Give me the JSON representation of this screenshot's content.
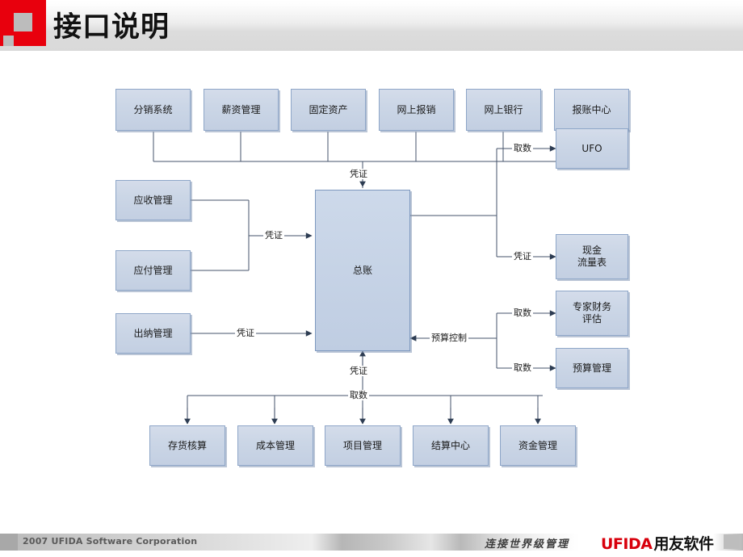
{
  "header": {
    "title": "接口说明",
    "logo_icon": "ufida-red-square-logo"
  },
  "diagram": {
    "hub": {
      "label": "总账"
    },
    "top_row": [
      {
        "label": "分销系统"
      },
      {
        "label": "薪资管理"
      },
      {
        "label": "固定资产"
      },
      {
        "label": "网上报销"
      },
      {
        "label": "网上银行"
      },
      {
        "label": "报账中心"
      }
    ],
    "left_column": [
      {
        "label": "应收管理"
      },
      {
        "label": "应付管理"
      },
      {
        "label": "出纳管理"
      }
    ],
    "right_column": [
      {
        "label": "UFO"
      },
      {
        "label": "现金\n流量表"
      },
      {
        "label": "专家财务\n评估"
      },
      {
        "label": "预算管理"
      }
    ],
    "bottom_row": [
      {
        "label": "存货核算"
      },
      {
        "label": "成本管理"
      },
      {
        "label": "项目管理"
      },
      {
        "label": "结算中心"
      },
      {
        "label": "资金管理"
      }
    ],
    "edge_labels": {
      "top_to_hub": "凭证",
      "receivable_payable_to_hub": "凭证",
      "cashier_to_hub": "凭证",
      "hub_to_ufo": "取数",
      "hub_to_cashflow": "凭证",
      "hub_to_expert": "取数",
      "hub_to_budget": "取数",
      "budget_control_to_hub": "预算控制",
      "bottom_to_hub_voucher": "凭证",
      "bottom_bus_fetch": "取数"
    }
  },
  "footer": {
    "copyright": "2007 UFIDA Software Corporation",
    "slogan": "连接世界级管理",
    "brand_en": "UFIDA",
    "brand_cn": "用友软件"
  }
}
